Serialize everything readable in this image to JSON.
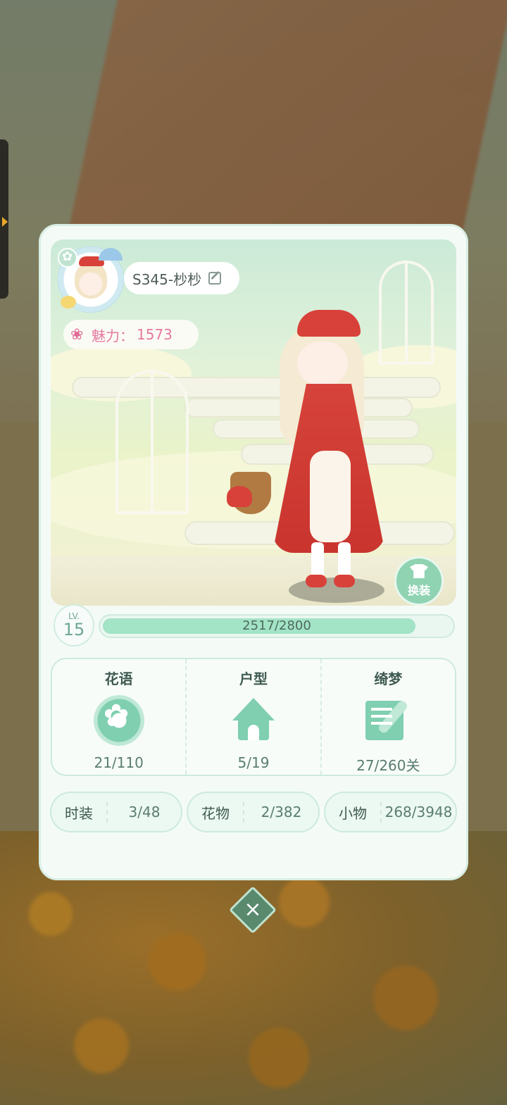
{
  "profile": {
    "name": "S345-杪杪",
    "charm_label": "魅力：",
    "charm_value": "1573",
    "change_outfit_label": "换装"
  },
  "level": {
    "lv_label": "LV.",
    "level": "15",
    "xp_text": "2517/2800",
    "xp_fraction": 0.899
  },
  "stats": [
    {
      "title": "花语",
      "value": "21/110",
      "icon": "flower-icon"
    },
    {
      "title": "户型",
      "value": "5/19",
      "icon": "house-icon"
    },
    {
      "title": "绮梦",
      "value": "27/260关",
      "icon": "dream-letter-icon"
    }
  ],
  "collections": [
    {
      "label": "时装",
      "value": "3/48"
    },
    {
      "label": "花物",
      "value": "2/382"
    },
    {
      "label": "小物",
      "value": "268/3948"
    }
  ],
  "close_label": "×",
  "colors": {
    "accent": "#7fcfb0",
    "charm_text": "#e57aa1",
    "panel": "#f4fbf7"
  }
}
